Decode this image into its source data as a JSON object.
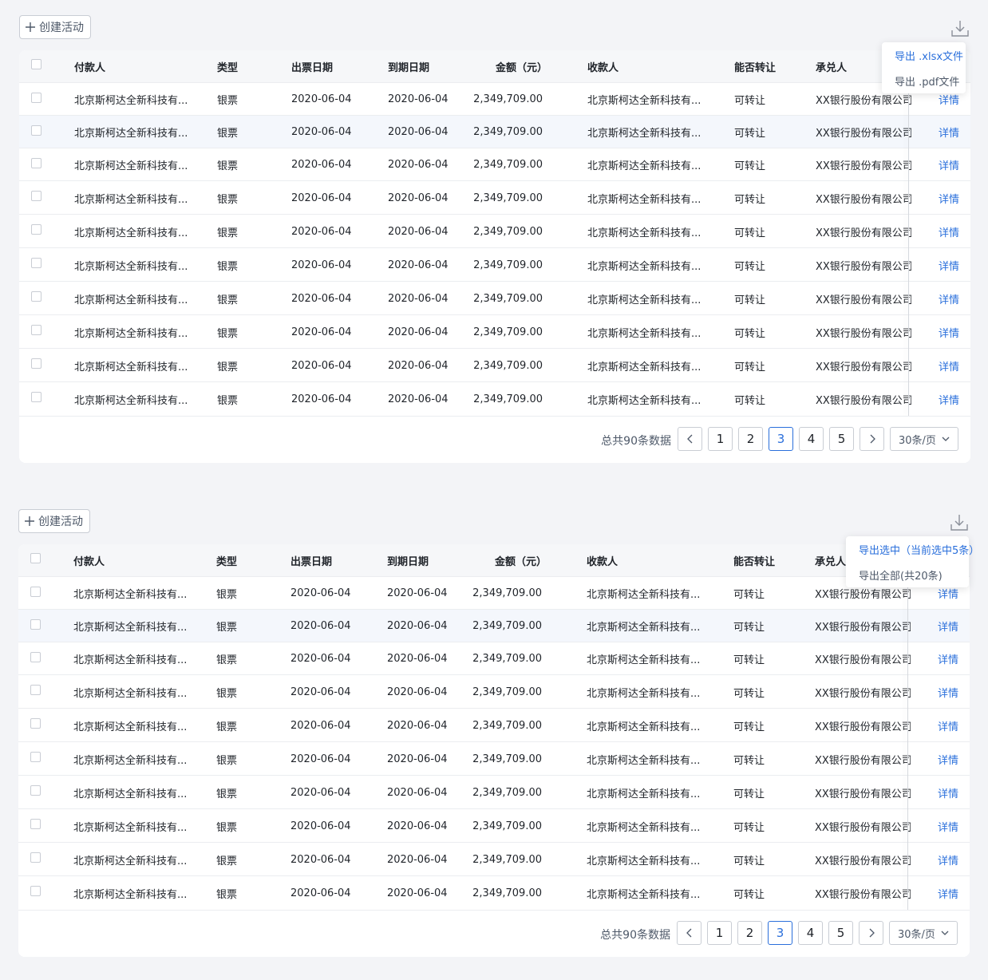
{
  "create_label": "创建活动",
  "columns": [
    "付款人",
    "类型",
    "出票日期",
    "到期日期",
    "金额（元）",
    "收款人",
    "能否转让",
    "承兑人"
  ],
  "rows": [
    {
      "payer": "北京斯柯达全新科技有...",
      "type": "银票",
      "issue_date": "2020-06-04",
      "due_date": "2020-06-04",
      "amount": "2,349,709.00",
      "payee": "北京斯柯达全新科技有...",
      "transfer": "可转让",
      "acceptor": "XX银行股份有限公司...",
      "action": "详情"
    },
    {
      "payer": "北京斯柯达全新科技有...",
      "type": "银票",
      "issue_date": "2020-06-04",
      "due_date": "2020-06-04",
      "amount": "2,349,709.00",
      "payee": "北京斯柯达全新科技有...",
      "transfer": "可转让",
      "acceptor": "XX银行股份有限公司...",
      "action": "详情"
    },
    {
      "payer": "北京斯柯达全新科技有...",
      "type": "银票",
      "issue_date": "2020-06-04",
      "due_date": "2020-06-04",
      "amount": "2,349,709.00",
      "payee": "北京斯柯达全新科技有...",
      "transfer": "可转让",
      "acceptor": "XX银行股份有限公司...",
      "action": "详情"
    },
    {
      "payer": "北京斯柯达全新科技有...",
      "type": "银票",
      "issue_date": "2020-06-04",
      "due_date": "2020-06-04",
      "amount": "2,349,709.00",
      "payee": "北京斯柯达全新科技有...",
      "transfer": "可转让",
      "acceptor": "XX银行股份有限公司...",
      "action": "详情"
    },
    {
      "payer": "北京斯柯达全新科技有...",
      "type": "银票",
      "issue_date": "2020-06-04",
      "due_date": "2020-06-04",
      "amount": "2,349,709.00",
      "payee": "北京斯柯达全新科技有...",
      "transfer": "可转让",
      "acceptor": "XX银行股份有限公司...",
      "action": "详情"
    },
    {
      "payer": "北京斯柯达全新科技有...",
      "type": "银票",
      "issue_date": "2020-06-04",
      "due_date": "2020-06-04",
      "amount": "2,349,709.00",
      "payee": "北京斯柯达全新科技有...",
      "transfer": "可转让",
      "acceptor": "XX银行股份有限公司...",
      "action": "详情"
    },
    {
      "payer": "北京斯柯达全新科技有...",
      "type": "银票",
      "issue_date": "2020-06-04",
      "due_date": "2020-06-04",
      "amount": "2,349,709.00",
      "payee": "北京斯柯达全新科技有...",
      "transfer": "可转让",
      "acceptor": "XX银行股份有限公司...",
      "action": "详情"
    },
    {
      "payer": "北京斯柯达全新科技有...",
      "type": "银票",
      "issue_date": "2020-06-04",
      "due_date": "2020-06-04",
      "amount": "2,349,709.00",
      "payee": "北京斯柯达全新科技有...",
      "transfer": "可转让",
      "acceptor": "XX银行股份有限公司...",
      "action": "详情"
    },
    {
      "payer": "北京斯柯达全新科技有...",
      "type": "银票",
      "issue_date": "2020-06-04",
      "due_date": "2020-06-04",
      "amount": "2,349,709.00",
      "payee": "北京斯柯达全新科技有...",
      "transfer": "可转让",
      "acceptor": "XX银行股份有限公司...",
      "action": "详情"
    },
    {
      "payer": "北京斯柯达全新科技有...",
      "type": "银票",
      "issue_date": "2020-06-04",
      "due_date": "2020-06-04",
      "amount": "2,349,709.00",
      "payee": "北京斯柯达全新科技有...",
      "transfer": "可转让",
      "acceptor": "XX银行股份有限公司...",
      "action": "详情"
    }
  ],
  "pagination": {
    "total_text": "总共90条数据",
    "pages": [
      "1",
      "2",
      "3",
      "4",
      "5"
    ],
    "current": "3",
    "prev_icon": "chevron-left-icon",
    "next_icon": "chevron-right-icon",
    "page_size": "30条/页"
  },
  "panels": [
    {
      "export_menu": [
        "导出 .xlsx文件",
        "导出 .pdf文件"
      ],
      "highlighted_index": 0
    },
    {
      "export_menu": [
        "导出选中（当前选中5条）",
        "导出全部(共20条)"
      ],
      "highlighted_index": 0
    }
  ],
  "icons": {
    "add": "plus-icon",
    "download": "download-icon",
    "caret": "chevron-down-icon"
  },
  "colors": {
    "accent": "#2a6fdb",
    "page_bg": "#f3f4f7",
    "header_bg": "#f6f7f9",
    "hover_row_bg": "#f4f7fc"
  }
}
